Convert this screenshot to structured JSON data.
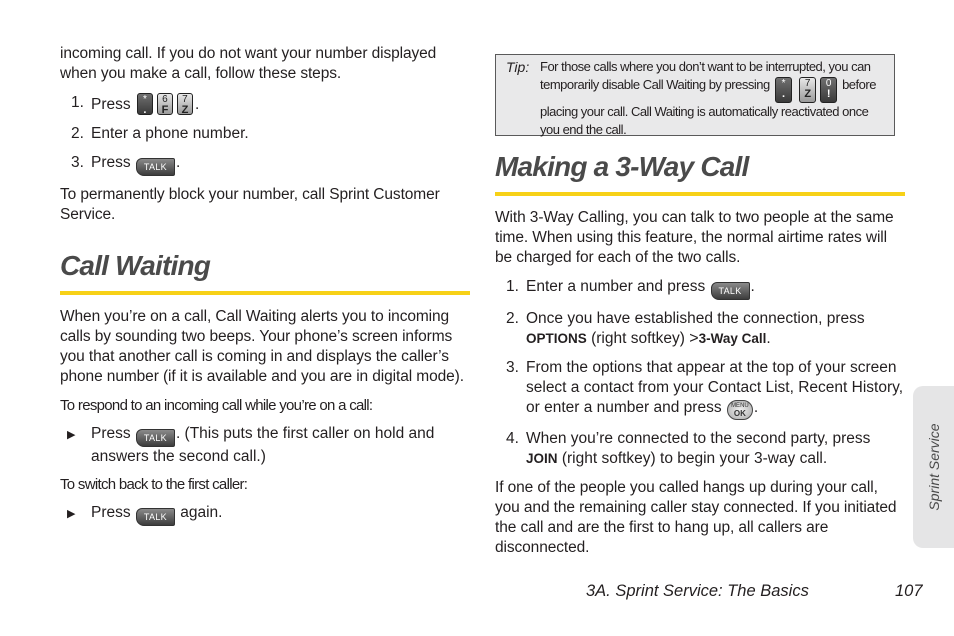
{
  "left": {
    "intro": "incoming call. If you do not want your number displayed when you make a call, follow these steps.",
    "block_steps": [
      {
        "num": "1.",
        "pre": "Press",
        "keys": [
          {
            "top": "*",
            "bot": ".",
            "dark": true
          },
          {
            "top": "6",
            "bot": "F",
            "dark": false
          },
          {
            "top": "7",
            "bot": "Z",
            "dark": false
          }
        ],
        "post": "."
      },
      {
        "num": "2.",
        "text": "Enter a phone number."
      },
      {
        "num": "3.",
        "pre": "Press",
        "key": "TALK",
        "post": "."
      }
    ],
    "block_note": "To permanently block your number, call Sprint Customer Service.",
    "call_waiting": {
      "heading": "Call Waiting",
      "body": "When you’re on a call, Call Waiting alerts you to incoming calls by sounding two beeps. Your phone’s screen informs you that another call is coming in and displays the caller’s phone number (if it is available and you are in digital mode).",
      "respond_label": "To respond to an incoming call while you’re on a call:",
      "respond_bullet": {
        "pre": "Press",
        "key": "TALK",
        "post": ". (This puts the first caller on hold and answers the second call.)"
      },
      "switch_label": "To switch back to the first caller:",
      "switch_bullet": {
        "pre": "Press",
        "key": "TALK",
        "post": " again."
      }
    }
  },
  "right": {
    "tip": {
      "label": "Tip:",
      "text1": "For those calls where you don’t want to be interrupted, you can temporarily disable Call Waiting by pressing",
      "keys": [
        {
          "top": "*",
          "bot": ".",
          "dark": true
        },
        {
          "top": "7",
          "bot": "Z",
          "dark": false
        },
        {
          "top": "0",
          "bot": "!",
          "dark": true
        }
      ],
      "text2": "before placing your call. Call Waiting is automatically reactivated once you end the call."
    },
    "three_way": {
      "heading": "Making a 3-Way Call",
      "intro": "With 3-Way Calling, you can talk to two people at the same time. When using this feature, the normal airtime rates will be charged for each of the two calls.",
      "steps": [
        {
          "num": "1.",
          "pre": "Enter a number and press",
          "key": "TALK",
          "post": "."
        },
        {
          "num": "2.",
          "pre": "Once you have established the connection, press",
          "bold1": "OPTIONS",
          "mid": "(right softkey)",
          "gt": ">",
          "bold2": "3-Way Call",
          "post": "."
        },
        {
          "num": "3.",
          "pre": "From the options that appear at the top of your screen select a contact from your Contact List, Recent History, or enter a number and press",
          "key_top": "MENU",
          "key_bot": "OK",
          "post": "."
        },
        {
          "num": "4.",
          "pre": "When you’re connected to the second party, press",
          "bold1": "JOIN",
          "post": "(right softkey) to begin your 3-way call."
        }
      ],
      "outro": "If one of the people you called hangs up during your call, you and the remaining caller stay connected. If you initiated the call and are the first to hang up, all callers are disconnected."
    }
  },
  "sidetab": {
    "label": "Sprint Service"
  },
  "footer": {
    "section": "3A. Sprint Service: The Basics",
    "page": "107"
  },
  "colors": {
    "accent_rule": "#f7d117",
    "tab_bg": "#e5e5e6",
    "tip_bg": "#e9e9ea"
  }
}
